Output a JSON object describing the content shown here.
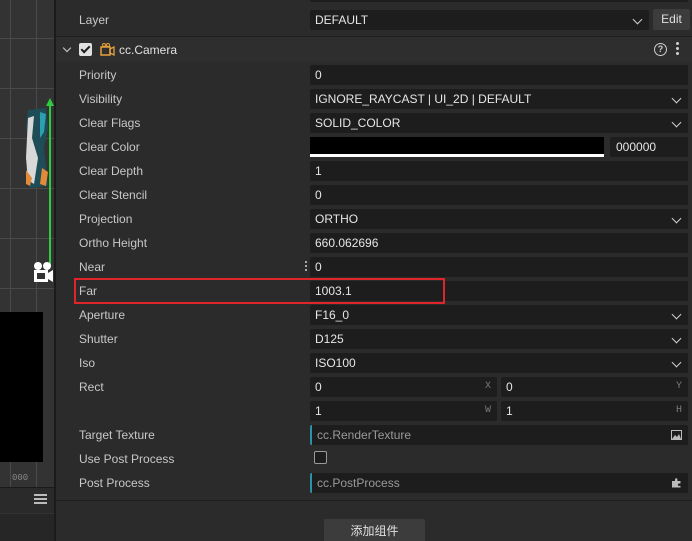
{
  "layer": {
    "label": "Layer",
    "value": "DEFAULT",
    "edit_label": "Edit"
  },
  "component": {
    "title": "cc.Camera",
    "help_glyph": "?"
  },
  "properties": {
    "priority": {
      "label": "Priority",
      "value": "0"
    },
    "visibility": {
      "label": "Visibility",
      "value": "IGNORE_RAYCAST | UI_2D | DEFAULT"
    },
    "clear_flags": {
      "label": "Clear Flags",
      "value": "SOLID_COLOR"
    },
    "clear_color": {
      "label": "Clear Color",
      "swatch_color": "#000000",
      "hex": "000000"
    },
    "clear_depth": {
      "label": "Clear Depth",
      "value": "1"
    },
    "clear_stencil": {
      "label": "Clear Stencil",
      "value": "0"
    },
    "projection": {
      "label": "Projection",
      "value": "ORTHO"
    },
    "ortho_height": {
      "label": "Ortho Height",
      "value": "660.062696"
    },
    "near": {
      "label": "Near",
      "value": "0"
    },
    "far": {
      "label": "Far",
      "value": "1003.1"
    },
    "aperture": {
      "label": "Aperture",
      "value": "F16_0"
    },
    "shutter": {
      "label": "Shutter",
      "value": "D125"
    },
    "iso": {
      "label": "Iso",
      "value": "ISO100"
    },
    "rect": {
      "label": "Rect",
      "x": "0",
      "y": "0",
      "w": "1",
      "h": "1",
      "x_letter": "X",
      "y_letter": "Y",
      "w_letter": "W",
      "h_letter": "H"
    },
    "target_texture": {
      "label": "Target Texture",
      "placeholder": "cc.RenderTexture"
    },
    "use_post_process": {
      "label": "Use Post Process",
      "checked": false
    },
    "post_process": {
      "label": "Post Process",
      "placeholder": "cc.PostProcess"
    }
  },
  "add_component_label": "添加组件",
  "scene": {
    "ruler_text": "000"
  },
  "colors": {
    "highlight": "#e0242a",
    "asset_accent": "#2a93a8",
    "axis_green": "#2ecc40"
  }
}
